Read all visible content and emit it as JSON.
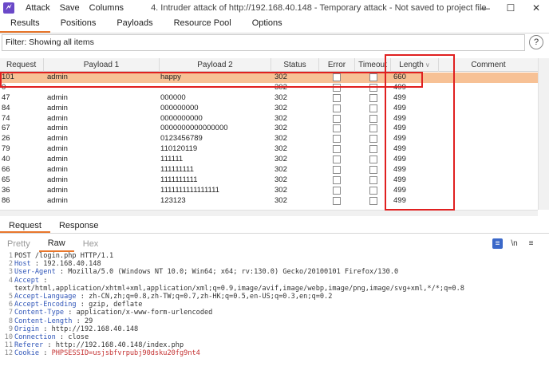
{
  "titlebar": {
    "app_icon": "burp-logo-icon",
    "menu": [
      "Attack",
      "Save",
      "Columns"
    ],
    "title": "4. Intruder attack of http://192.168.40.148 - Temporary attack - Not saved to project file",
    "controls": [
      "minimize-icon",
      "maximize-icon",
      "close-icon"
    ]
  },
  "top_tabs": [
    "Results",
    "Positions",
    "Payloads",
    "Resource Pool",
    "Options"
  ],
  "filter": {
    "text": "Filter: Showing all items",
    "help": "?"
  },
  "table": {
    "columns": [
      "Request",
      "Payload 1",
      "Payload 2",
      "Status",
      "Error",
      "Timeout",
      "Length",
      "Comment"
    ],
    "sort_column": "Length",
    "rows": [
      {
        "request": "101",
        "p1": "admin",
        "p2": "happy",
        "status": "302",
        "length": "660",
        "selected": true
      },
      {
        "request": "0",
        "p1": "",
        "p2": "",
        "status": "302",
        "length": "499"
      },
      {
        "request": "47",
        "p1": "admin",
        "p2": "000000",
        "status": "302",
        "length": "499"
      },
      {
        "request": "84",
        "p1": "admin",
        "p2": "000000000",
        "status": "302",
        "length": "499"
      },
      {
        "request": "74",
        "p1": "admin",
        "p2": "0000000000",
        "status": "302",
        "length": "499"
      },
      {
        "request": "67",
        "p1": "admin",
        "p2": "0000000000000000",
        "status": "302",
        "length": "499"
      },
      {
        "request": "26",
        "p1": "admin",
        "p2": "0123456789",
        "status": "302",
        "length": "499"
      },
      {
        "request": "79",
        "p1": "admin",
        "p2": "110120119",
        "status": "302",
        "length": "499"
      },
      {
        "request": "40",
        "p1": "admin",
        "p2": "111111",
        "status": "302",
        "length": "499"
      },
      {
        "request": "66",
        "p1": "admin",
        "p2": "111111111",
        "status": "302",
        "length": "499"
      },
      {
        "request": "65",
        "p1": "admin",
        "p2": "1111111111",
        "status": "302",
        "length": "499"
      },
      {
        "request": "36",
        "p1": "admin",
        "p2": "1111111111111111",
        "status": "302",
        "length": "499"
      },
      {
        "request": "86",
        "p1": "admin",
        "p2": "123123",
        "status": "302",
        "length": "499"
      }
    ]
  },
  "bottom_tabs": [
    "Request",
    "Response"
  ],
  "sub_tabs": [
    "Pretty",
    "Raw",
    "Hex"
  ],
  "tool_icons": [
    "wrap-lines-icon",
    "\\n"
  ],
  "request_lines": [
    {
      "n": "1",
      "key": "",
      "val": "POST /login.php  HTTP/1.1"
    },
    {
      "n": "2",
      "key": "Host",
      "val": " : 192.168.40.148"
    },
    {
      "n": "3",
      "key": "User-Agent",
      "val": " : Mozilla/5.0  (Windows  NT 10.0;  Win64;  x64;  rv:130.0)  Gecko/20100101  Firefox/130.0"
    },
    {
      "n": "4",
      "key": "Accept",
      "val": " :"
    },
    {
      "n": "",
      "key": "",
      "val": "text/html,application/xhtml+xml,application/xml;q=0.9,image/avif,image/webp,image/png,image/svg+xml,*/*;q=0.8"
    },
    {
      "n": "5",
      "key": "Accept-Language",
      "val": " : zh-CN,zh;q=0.8,zh-TW;q=0.7,zh-HK;q=0.5,en-US;q=0.3,en;q=0.2"
    },
    {
      "n": "6",
      "key": "Accept-Encoding",
      "val": " : gzip,  deflate"
    },
    {
      "n": "7",
      "key": "Content-Type",
      "val": " : application/x-www-form-urlencoded"
    },
    {
      "n": "8",
      "key": "Content-Length",
      "val": " : 29"
    },
    {
      "n": "9",
      "key": "Origin",
      "val": " : http://192.168.40.148"
    },
    {
      "n": "10",
      "key": "Connection",
      "val": " : close"
    },
    {
      "n": "11",
      "key": "Referer",
      "val": " : http://192.168.40.148/index.php"
    },
    {
      "n": "12",
      "key": "Cookie",
      "val": " : ",
      "cookie": "PHPSESSID=usjsbfvrpubj90dsku20fg9nt4"
    }
  ]
}
